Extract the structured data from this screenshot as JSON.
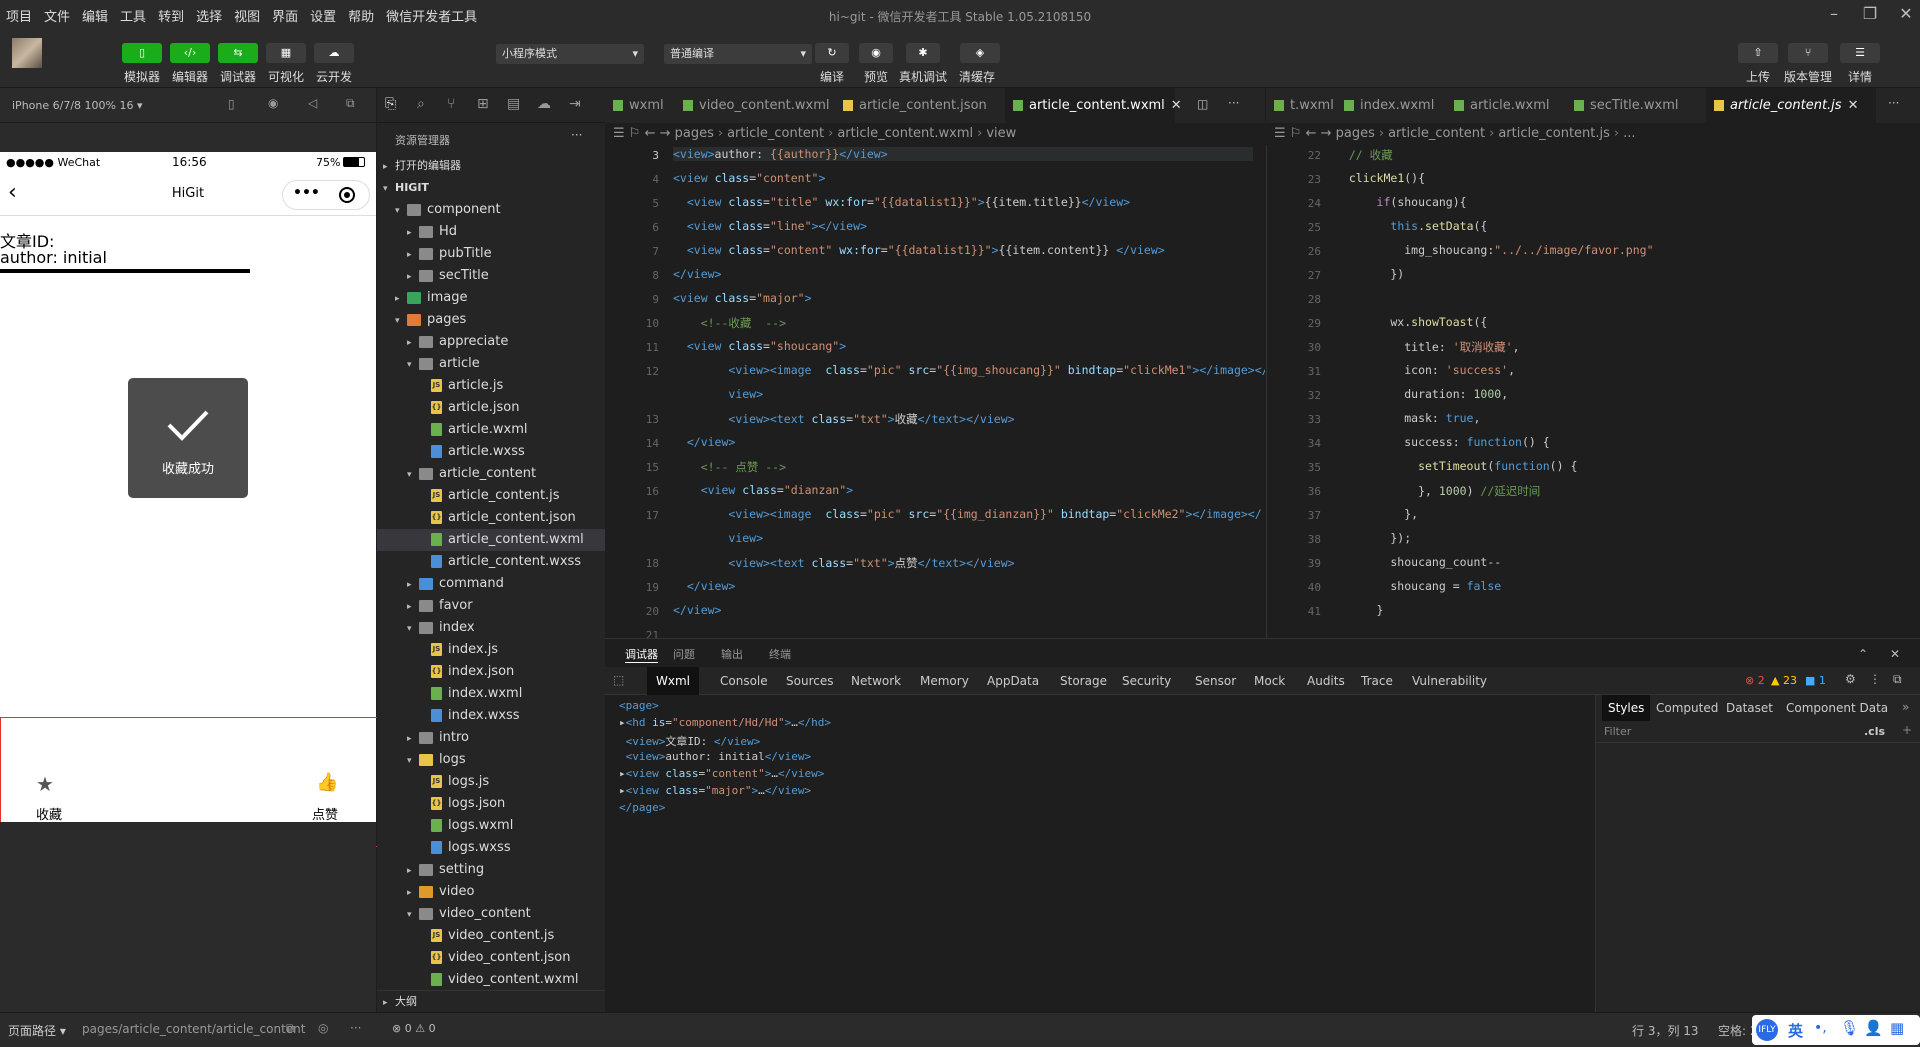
{
  "menu": [
    "项目",
    "文件",
    "编辑",
    "工具",
    "转到",
    "选择",
    "视图",
    "界面",
    "设置",
    "帮助",
    "微信开发者工具"
  ],
  "window_title": "hi~git - 微信开发者工具 Stable 1.05.2108150",
  "toolbar": {
    "left_buttons": [
      "模拟器",
      "编辑器",
      "调试器",
      "可视化",
      "云开发"
    ],
    "mode_select": "小程序模式",
    "compile_select": "普通编译",
    "mid_buttons": [
      "编译",
      "预览",
      "真机调试",
      "清缓存"
    ],
    "right_buttons": [
      "上传",
      "版本管理",
      "详情"
    ]
  },
  "sim": {
    "device": "iPhone 6/7/8 100% 16 ▾",
    "carrier": "●●●●● WeChat",
    "time": "16:56",
    "battery": "75%",
    "nav_title": "HiGit",
    "article_id_label": "文章ID:",
    "author_label": "author:  initial",
    "toast_text": "收藏成功",
    "fav_label": "收藏",
    "like_label": "点赞"
  },
  "explorer": {
    "title": "资源管理器",
    "open_editors": "打开的编辑器",
    "root": "HIGIT",
    "outline": "大纲",
    "items": [
      {
        "d": 1,
        "t": "folder",
        "open": true,
        "n": "component"
      },
      {
        "d": 2,
        "t": "folder",
        "open": false,
        "n": "Hd"
      },
      {
        "d": 2,
        "t": "folder",
        "open": false,
        "n": "pubTitle"
      },
      {
        "d": 2,
        "t": "folder",
        "open": false,
        "n": "secTitle"
      },
      {
        "d": 1,
        "t": "imgfolder",
        "open": false,
        "n": "image"
      },
      {
        "d": 1,
        "t": "pagesfolder",
        "open": true,
        "n": "pages"
      },
      {
        "d": 2,
        "t": "folder",
        "open": false,
        "n": "appreciate"
      },
      {
        "d": 2,
        "t": "folder",
        "open": true,
        "n": "article"
      },
      {
        "d": 3,
        "t": "js",
        "n": "article.js"
      },
      {
        "d": 3,
        "t": "json",
        "n": "article.json"
      },
      {
        "d": 3,
        "t": "wxml",
        "n": "article.wxml"
      },
      {
        "d": 3,
        "t": "wxss",
        "n": "article.wxss"
      },
      {
        "d": 2,
        "t": "folder",
        "open": true,
        "n": "article_content"
      },
      {
        "d": 3,
        "t": "js",
        "n": "article_content.js"
      },
      {
        "d": 3,
        "t": "json",
        "n": "article_content.json"
      },
      {
        "d": 3,
        "t": "wxml",
        "n": "article_content.wxml",
        "sel": true
      },
      {
        "d": 3,
        "t": "wxss",
        "n": "article_content.wxss"
      },
      {
        "d": 2,
        "t": "cmdfolder",
        "open": false,
        "n": "command"
      },
      {
        "d": 2,
        "t": "folder",
        "open": false,
        "n": "favor"
      },
      {
        "d": 2,
        "t": "folder",
        "open": true,
        "n": "index"
      },
      {
        "d": 3,
        "t": "js",
        "n": "index.js"
      },
      {
        "d": 3,
        "t": "json",
        "n": "index.json"
      },
      {
        "d": 3,
        "t": "wxml",
        "n": "index.wxml"
      },
      {
        "d": 3,
        "t": "wxss",
        "n": "index.wxss"
      },
      {
        "d": 2,
        "t": "folder",
        "open": false,
        "n": "intro"
      },
      {
        "d": 2,
        "t": "logfolder",
        "open": true,
        "n": "logs"
      },
      {
        "d": 3,
        "t": "js",
        "n": "logs.js"
      },
      {
        "d": 3,
        "t": "json",
        "n": "logs.json"
      },
      {
        "d": 3,
        "t": "wxml",
        "n": "logs.wxml"
      },
      {
        "d": 3,
        "t": "wxss",
        "n": "logs.wxss"
      },
      {
        "d": 2,
        "t": "folder",
        "open": false,
        "n": "setting"
      },
      {
        "d": 2,
        "t": "vidfolder",
        "open": false,
        "n": "video"
      },
      {
        "d": 2,
        "t": "folder",
        "open": true,
        "n": "video_content"
      },
      {
        "d": 3,
        "t": "js",
        "n": "video_content.js"
      },
      {
        "d": 3,
        "t": "json",
        "n": "video_content.json"
      },
      {
        "d": 3,
        "t": "wxml",
        "n": "video_content.wxml"
      }
    ]
  },
  "editor1": {
    "tabs": [
      {
        "n": "wxml",
        "t": "wxml"
      },
      {
        "n": "video_content.wxml",
        "t": "wxml"
      },
      {
        "n": "article_content.json",
        "t": "json"
      },
      {
        "n": "article_content.wxml",
        "t": "wxml",
        "active": true
      }
    ],
    "breadcrumb": [
      "pages",
      "article_content",
      "article_content.wxml",
      "view"
    ],
    "lines": [
      {
        "n": "3",
        "h": "<span class='tg'>&lt;view&gt;</span>author: <span class='st'>{{author}}</span><span class='tg'>&lt;/view&gt;</span>"
      },
      {
        "n": "4",
        "h": "<span class='tg'>&lt;view</span> <span class='at'>class</span>=<span class='st'>\"content\"</span><span class='tg'>&gt;</span>"
      },
      {
        "n": "5",
        "h": "  <span class='tg'>&lt;view</span> <span class='at'>class</span>=<span class='st'>\"title\"</span> <span class='at'>wx:for</span>=<span class='st'>\"{{datalist1}}\"</span><span class='tg'>&gt;</span>{{item.title}}<span class='tg'>&lt;/view&gt;</span>"
      },
      {
        "n": "6",
        "h": "  <span class='tg'>&lt;view</span> <span class='at'>class</span>=<span class='st'>\"line\"</span><span class='tg'>&gt;&lt;/view&gt;</span>"
      },
      {
        "n": "7",
        "h": "  <span class='tg'>&lt;view</span> <span class='at'>class</span>=<span class='st'>\"content\"</span> <span class='at'>wx:for</span>=<span class='st'>\"{{datalist1}}\"</span><span class='tg'>&gt;</span>{{item.content}} <span class='tg'>&lt;/view&gt;</span>"
      },
      {
        "n": "8",
        "h": "<span class='tg'>&lt;/view&gt;</span>"
      },
      {
        "n": "9",
        "h": "<span class='tg'>&lt;view</span> <span class='at'>class</span>=<span class='st'>\"major\"</span><span class='tg'>&gt;</span>"
      },
      {
        "n": "10",
        "h": "    <span class='cm'>&lt;!--收藏  --&gt;</span>"
      },
      {
        "n": "11",
        "h": "  <span class='tg'>&lt;view</span> <span class='at'>class</span>=<span class='st'>\"shoucang\"</span><span class='tg'>&gt;</span>"
      },
      {
        "n": "12",
        "h": "        <span class='tg'>&lt;view&gt;&lt;image</span>  <span class='at'>class</span>=<span class='st'>\"pic\"</span> <span class='at'>src</span>=<span class='st'>\"{{img_shoucang}}\"</span> <span class='at'>bindtap</span>=<span class='st'>\"clickMe1\"</span><span class='tg'>&gt;&lt;/image&gt;&lt;/</span>"
      },
      {
        "n": "",
        "h": "        <span class='tg'>view&gt;</span>"
      },
      {
        "n": "13",
        "h": "        <span class='tg'>&lt;view&gt;&lt;text</span> <span class='at'>class</span>=<span class='st'>\"txt\"</span><span class='tg'>&gt;</span>收藏<span class='tg'>&lt;/text&gt;&lt;/view&gt;</span>"
      },
      {
        "n": "14",
        "h": "  <span class='tg'>&lt;/view&gt;</span>"
      },
      {
        "n": "15",
        "h": "    <span class='cm'>&lt;!-- 点赞 --&gt;</span>"
      },
      {
        "n": "16",
        "h": "    <span class='tg'>&lt;view</span> <span class='at'>class</span>=<span class='st'>\"dianzan\"</span><span class='tg'>&gt;</span>"
      },
      {
        "n": "17",
        "h": "        <span class='tg'>&lt;view&gt;&lt;image</span>  <span class='at'>class</span>=<span class='st'>\"pic\"</span> <span class='at'>src</span>=<span class='st'>\"{{img_dianzan}}\"</span> <span class='at'>bindtap</span>=<span class='st'>\"clickMe2\"</span><span class='tg'>&gt;&lt;/image&gt;&lt;/</span>"
      },
      {
        "n": "",
        "h": "        <span class='tg'>view&gt;</span>"
      },
      {
        "n": "18",
        "h": "        <span class='tg'>&lt;view&gt;&lt;text</span> <span class='at'>class</span>=<span class='st'>\"txt\"</span><span class='tg'>&gt;</span>点赞<span class='tg'>&lt;/text&gt;&lt;/view&gt;</span>"
      },
      {
        "n": "19",
        "h": "  <span class='tg'>&lt;/view&gt;</span>"
      },
      {
        "n": "20",
        "h": "<span class='tg'>&lt;/view&gt;</span>"
      },
      {
        "n": "21",
        "h": ""
      }
    ]
  },
  "editor2": {
    "tabs": [
      {
        "n": "t.wxml",
        "t": "wxml"
      },
      {
        "n": "index.wxml",
        "t": "wxml"
      },
      {
        "n": "article.wxml",
        "t": "wxml"
      },
      {
        "n": "secTitle.wxml",
        "t": "wxml"
      },
      {
        "n": "article_content.js",
        "t": "js",
        "active": true
      }
    ],
    "breadcrumb": [
      "pages",
      "article_content",
      "article_content.js",
      "..."
    ],
    "lines": [
      {
        "n": "22",
        "h": "  <span class='cm'>// 收藏</span>"
      },
      {
        "n": "23",
        "h": "  <span class='fn'>clickMe1</span>(){"
      },
      {
        "n": "24",
        "h": "      <span class='kw'>if</span>(shoucang){"
      },
      {
        "n": "25",
        "h": "        <span class='bl'>this</span>.<span class='fn'>setData</span>({"
      },
      {
        "n": "26",
        "h": "          img_shoucang:<span class='st'>\"../../image/favor.png\"</span>"
      },
      {
        "n": "27",
        "h": "        })"
      },
      {
        "n": "28",
        "h": ""
      },
      {
        "n": "29",
        "h": "        wx.<span class='fn'>showToast</span>({"
      },
      {
        "n": "30",
        "h": "          title: <span class='st'>'取消收藏'</span>,"
      },
      {
        "n": "31",
        "h": "          icon: <span class='st'>'success'</span>,"
      },
      {
        "n": "32",
        "h": "          duration: <span class='nm'>1000</span>,"
      },
      {
        "n": "33",
        "h": "          mask: <span class='bl'>true</span>,"
      },
      {
        "n": "34",
        "h": "          success: <span class='bl'>function</span>() {"
      },
      {
        "n": "35",
        "h": "            <span class='fn'>setTimeout</span>(<span class='bl'>function</span>() {"
      },
      {
        "n": "36",
        "h": "            }, <span class='nm'>1000</span>) <span class='cm'>//延迟时间</span>"
      },
      {
        "n": "37",
        "h": "          },"
      },
      {
        "n": "38",
        "h": "        });"
      },
      {
        "n": "39",
        "h": "        shoucang_count--"
      },
      {
        "n": "40",
        "h": "        shoucang = <span class='bl'>false</span>"
      },
      {
        "n": "41",
        "h": "      }"
      }
    ]
  },
  "devtools": {
    "panel_tabs": [
      "调试器",
      "问题",
      "输出",
      "终端"
    ],
    "tabs": [
      "Wxml",
      "Console",
      "Sources",
      "Network",
      "Memory",
      "AppData",
      "Storage",
      "Security",
      "Sensor",
      "Mock",
      "Audits",
      "Trace",
      "Vulnerability"
    ],
    "errors": "2",
    "warnings": "23",
    "infos": "1",
    "dom": [
      {
        "h": "<span class='tg'>&lt;page&gt;</span>"
      },
      {
        "h": "▸<span class='tg'>&lt;hd</span> <span class='at'>is</span>=<span class='st'>\"component/Hd/Hd\"</span><span class='tg'>&gt;</span>…<span class='tg'>&lt;/hd&gt;</span>"
      },
      {
        "h": " <span class='tg'>&lt;view&gt;</span>文章ID: <span class='tg'>&lt;/view&gt;</span>"
      },
      {
        "h": " <span class='tg'>&lt;view&gt;</span>author: initial<span class='tg'>&lt;/view&gt;</span>"
      },
      {
        "h": "▸<span class='tg'>&lt;view</span> <span class='at'>class</span>=<span class='st'>\"content\"</span><span class='tg'>&gt;</span>…<span class='tg'>&lt;/view&gt;</span>"
      },
      {
        "h": "▸<span class='tg'>&lt;view</span> <span class='at'>class</span>=<span class='st'>\"major\"</span><span class='tg'>&gt;</span>…<span class='tg'>&lt;/view&gt;</span>"
      },
      {
        "h": "<span class='tg'>&lt;/page&gt;</span>"
      }
    ],
    "style_tabs": [
      "Styles",
      "Computed",
      "Dataset",
      "Component Data"
    ],
    "filter_placeholder": "Filter",
    "cls": ".cls"
  },
  "status": {
    "page_path_label": "页面路径 ▾",
    "page_path": "pages/article_content/article_content",
    "errs": "⊗ 0 ⚠ 0",
    "cursor": "行 3，列 13",
    "spaces": "空格: 2",
    "ime": "英"
  },
  "colors": {
    "green": "#1aad19",
    "accent": "#0e639c"
  }
}
